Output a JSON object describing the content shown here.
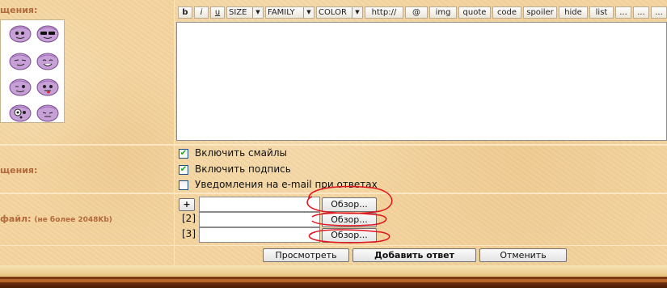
{
  "labels": {
    "message_row": "щения:",
    "options_row": "щения:",
    "file_row": "файл:",
    "file_limit": "(не более 2048Kb)"
  },
  "toolbar": {
    "bold": "b",
    "italic": "i",
    "underline": "u",
    "size": "SIZE",
    "family": "FAMILY",
    "color": "COLOR",
    "url": "http://",
    "email": "@",
    "img": "img",
    "quote": "quote",
    "code": "code",
    "spoiler": "spoiler",
    "hide": "hide",
    "list": "list",
    "more1": "...",
    "more2": "...",
    "more3": "..."
  },
  "editor": {
    "value": ""
  },
  "options": [
    {
      "label": "Включить смайлы",
      "checked": true
    },
    {
      "label": "Включить подпись",
      "checked": true
    },
    {
      "label": "Уведомления на e-mail при ответах",
      "checked": false
    }
  ],
  "attachments": {
    "add_label": "+",
    "rows": [
      {
        "index": "",
        "browse": "Обзор..."
      },
      {
        "index": "[2]",
        "browse": "Обзор..."
      },
      {
        "index": "[3]",
        "browse": "Обзор..."
      }
    ]
  },
  "actions": {
    "preview": "Просмотреть",
    "submit": "Добавить ответ",
    "cancel": "Отменить"
  },
  "colors": {
    "label_text": "#b36a3c",
    "background": "#f3d49f",
    "annotation": "#e0141c",
    "check": "#21a121"
  },
  "smileys": [
    "smiley-blush-icon",
    "smiley-sunglasses-icon",
    "smiley-sly-icon",
    "smiley-grin-icon",
    "smiley-wink-icon",
    "smiley-tongue-icon",
    "smiley-surprised-icon",
    "smiley-squint-icon"
  ]
}
